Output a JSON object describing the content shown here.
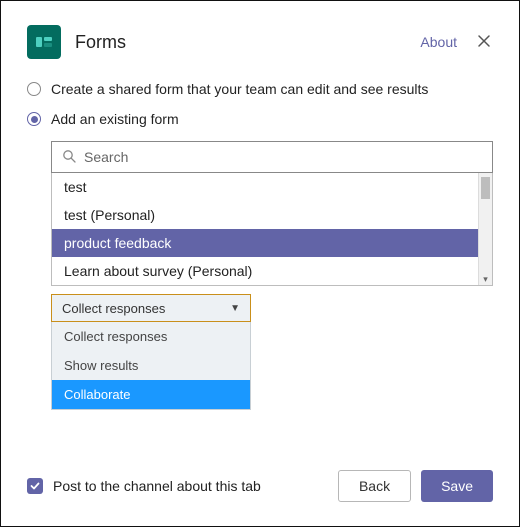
{
  "header": {
    "title": "Forms",
    "about_label": "About"
  },
  "options": {
    "create_label": "Create a shared form that your team can edit and see results",
    "add_label": "Add an existing form"
  },
  "search": {
    "placeholder": "Search",
    "items": [
      "test",
      "test (Personal)",
      "product feedback",
      "Learn about survey (Personal)"
    ],
    "selected_index": 2
  },
  "dropdown": {
    "selected": "Collect responses",
    "items": [
      "Collect responses",
      "Show results",
      "Collaborate"
    ],
    "highlight_index": 2
  },
  "footer": {
    "checkbox_label": "Post to the channel about this tab",
    "back_label": "Back",
    "save_label": "Save"
  }
}
